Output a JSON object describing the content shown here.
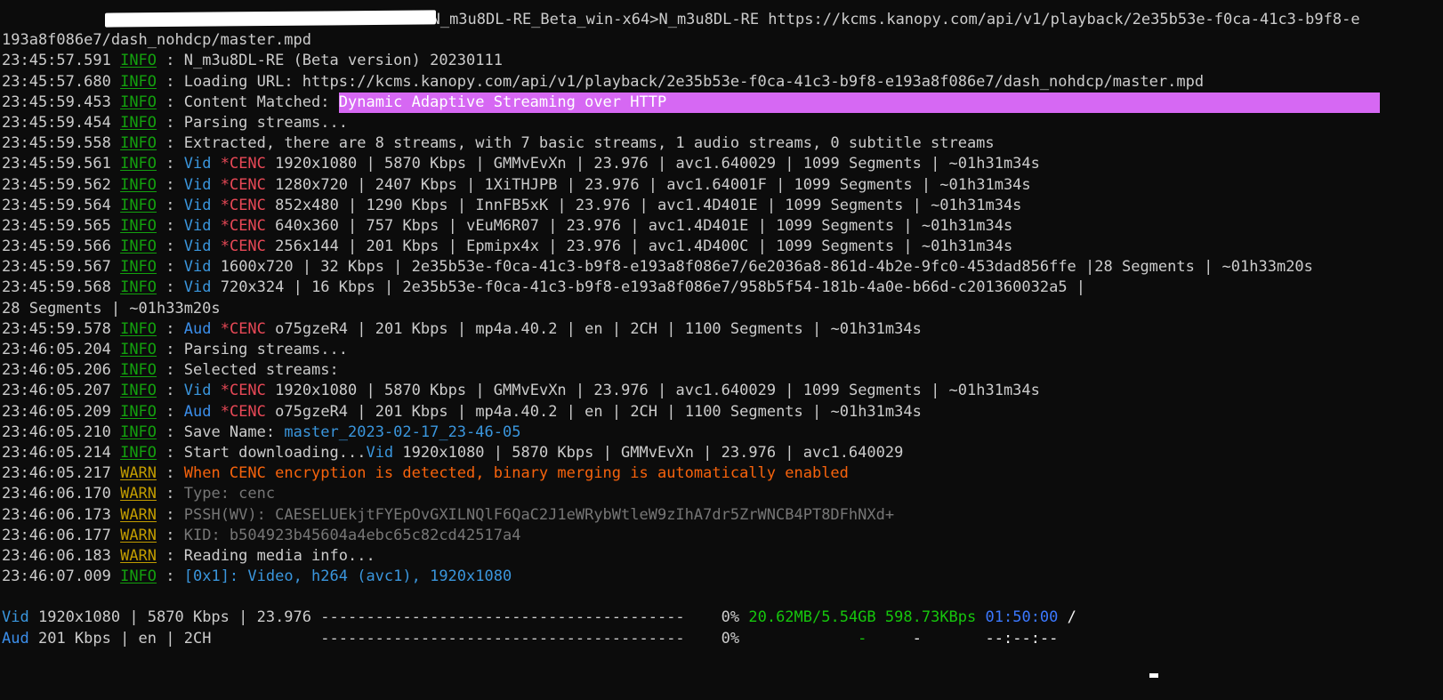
{
  "prompt": {
    "path_suffix": "N_m3u8DL-RE_Beta_win-x64>",
    "command": "N_m3u8DL-RE https://kcms.kanopy.com/api/v1/playback/2e35b53e-f0ca-41c3-b9f8-e",
    "command_wrap": "193a8f086e7/dash_nohdcp/master.mpd"
  },
  "logs": [
    {
      "time": "23:45:57.591",
      "level": "INFO",
      "msg": "N_m3u8DL-RE (Beta version) 20230111"
    },
    {
      "time": "23:45:57.680",
      "level": "INFO",
      "msg": "Loading URL: https://kcms.kanopy.com/api/v1/playback/2e35b53e-f0ca-41c3-b9f8-e193a8f086e7/dash_nohdcp/master.mpd"
    },
    {
      "time": "23:45:59.453",
      "level": "INFO",
      "msg": "Content Matched: ",
      "highlight": "Dynamic Adaptive Streaming over HTTP"
    },
    {
      "time": "23:45:59.454",
      "level": "INFO",
      "msg": "Parsing streams..."
    },
    {
      "time": "23:45:59.558",
      "level": "INFO",
      "msg": "Extracted, there are 8 streams, with 7 basic streams, 1 audio streams, 0 subtitle streams"
    },
    {
      "time": "23:45:59.561",
      "level": "INFO",
      "type": "Vid",
      "cenc": "*CENC",
      "msg": "1920x1080 | 5870 Kbps | GMMvEvXn | 23.976 | avc1.640029 | 1099 Segments | ~01h31m34s"
    },
    {
      "time": "23:45:59.562",
      "level": "INFO",
      "type": "Vid",
      "cenc": "*CENC",
      "msg": "1280x720 | 2407 Kbps | 1XiTHJPB | 23.976 | avc1.64001F | 1099 Segments | ~01h31m34s"
    },
    {
      "time": "23:45:59.564",
      "level": "INFO",
      "type": "Vid",
      "cenc": "*CENC",
      "msg": "852x480 | 1290 Kbps | InnFB5xK | 23.976 | avc1.4D401E | 1099 Segments | ~01h31m34s"
    },
    {
      "time": "23:45:59.565",
      "level": "INFO",
      "type": "Vid",
      "cenc": "*CENC",
      "msg": "640x360 | 757 Kbps | vEuM6R07 | 23.976 | avc1.4D401E | 1099 Segments | ~01h31m34s"
    },
    {
      "time": "23:45:59.566",
      "level": "INFO",
      "type": "Vid",
      "cenc": "*CENC",
      "msg": "256x144 | 201 Kbps | Epmipx4x | 23.976 | avc1.4D400C | 1099 Segments | ~01h31m34s"
    },
    {
      "time": "23:45:59.567",
      "level": "INFO",
      "type": "Vid",
      "msg": "1600x720 | 32 Kbps | 2e35b53e-f0ca-41c3-b9f8-e193a8f086e7/6e2036a8-861d-4b2e-9fc0-453dad856ffe |28 Segments | ~01h33m20s"
    },
    {
      "time": "23:45:59.568",
      "level": "INFO",
      "type": "Vid",
      "msg": "720x324 | 16 Kbps | 2e35b53e-f0ca-41c3-b9f8-e193a8f086e7/958b5f54-181b-4a0e-b66d-c201360032a5 |"
    },
    {
      "wrap": "28 Segments | ~01h33m20s"
    },
    {
      "time": "23:45:59.578",
      "level": "INFO",
      "type": "Aud",
      "cenc": "*CENC",
      "msg": "o75gzeR4 | 201 Kbps | mp4a.40.2 | en | 2CH | 1100 Segments | ~01h31m34s"
    },
    {
      "time": "23:46:05.204",
      "level": "INFO",
      "msg": "Parsing streams..."
    },
    {
      "time": "23:46:05.206",
      "level": "INFO",
      "msg": "Selected streams:"
    },
    {
      "time": "23:46:05.207",
      "level": "INFO",
      "type": "Vid",
      "cenc": "*CENC",
      "msg": "1920x1080 | 5870 Kbps | GMMvEvXn | 23.976 | avc1.640029 | 1099 Segments | ~01h31m34s"
    },
    {
      "time": "23:46:05.209",
      "level": "INFO",
      "type": "Aud",
      "cenc": "*CENC",
      "msg": "o75gzeR4 | 201 Kbps | mp4a.40.2 | en | 2CH | 1100 Segments | ~01h31m34s"
    },
    {
      "time": "23:46:05.210",
      "level": "INFO",
      "msg": "Save Name: ",
      "cyan": "master_2023-02-17_23-46-05"
    },
    {
      "time": "23:46:05.214",
      "level": "INFO",
      "msg": "Start downloading...",
      "type_inline": "Vid",
      "msg2": "1920x1080 | 5870 Kbps | GMMvEvXn | 23.976 | avc1.640029"
    },
    {
      "time": "23:46:05.217",
      "level": "WARN",
      "orange": "When CENC encryption is detected, binary merging is automatically enabled"
    },
    {
      "time": "23:46:06.170",
      "level": "WARN",
      "dim": "Type: cenc"
    },
    {
      "time": "23:46:06.173",
      "level": "WARN",
      "dim": "PSSH(WV): CAESELUEkjtFYEpOvGXILNQlF6QaC2J1eWRybWtleW9zIhA7dr5ZrWNCB4PT8DFhNXd+"
    },
    {
      "time": "23:46:06.177",
      "level": "WARN",
      "dim": "KID: b504923b45604a4ebc65c82cd42517a4"
    },
    {
      "time": "23:46:06.183",
      "level": "WARN",
      "msg": "Reading media info..."
    },
    {
      "time": "23:46:07.009",
      "level": "INFO",
      "cyan": "[0x1]: Video, h264 (avc1), 1920x1080"
    }
  ],
  "progress": {
    "video": {
      "type": "Vid",
      "desc": "1920x1080 | 5870 Kbps | 23.976",
      "bar": "----------------------------------------",
      "percent": "0%",
      "percent_value": 0,
      "size": "20.62MB/5.54GB",
      "speed": "598.73KBps",
      "eta": "01:50:00",
      "tail": "/"
    },
    "audio": {
      "type": "Aud",
      "desc": "201 Kbps | en | 2CH",
      "bar": "----------------------------------------",
      "percent": "0%",
      "percent_value": 0,
      "size": "-",
      "speed": "-",
      "eta": "--:--:--"
    }
  }
}
